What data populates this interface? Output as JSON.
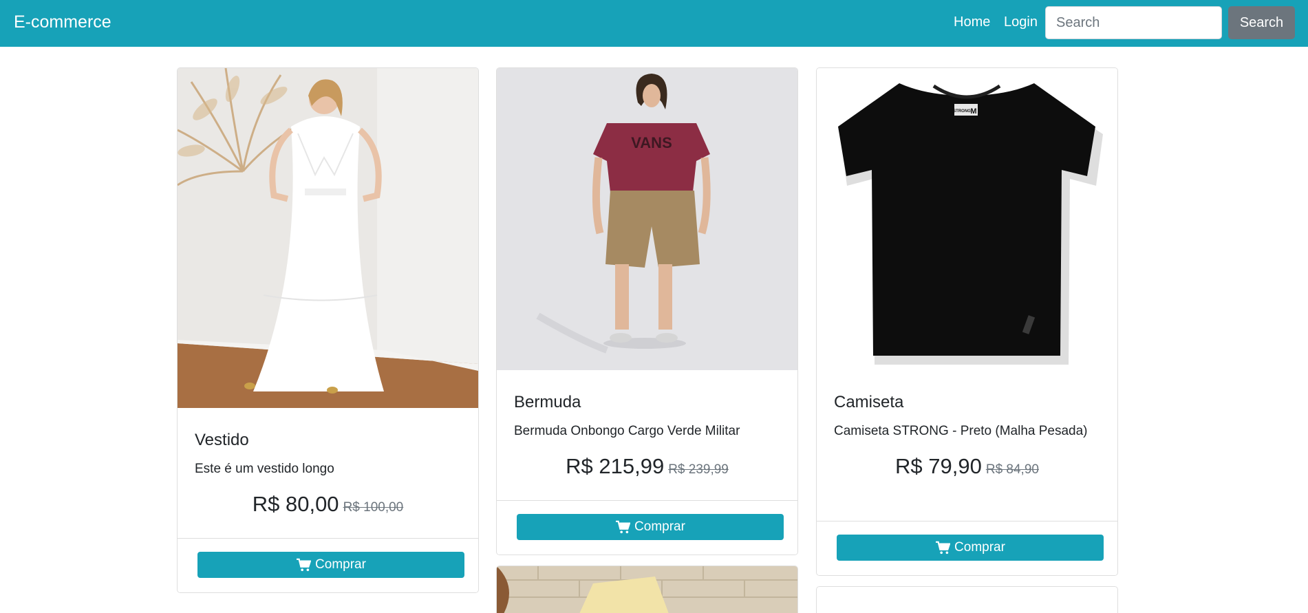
{
  "navbar": {
    "brand": "E-commerce",
    "links": [
      "Home",
      "Login"
    ],
    "search_placeholder": "Search",
    "search_button": "Search"
  },
  "products": [
    {
      "title": "Vestido",
      "description": "Este é um vestido longo",
      "price": "R$ 80,00",
      "old_price": "R$ 100,00",
      "button": "Comprar",
      "image_icon": "white-dress-photo"
    },
    {
      "title": "Bermuda",
      "description": "Bermuda Onbongo Cargo Verde Militar",
      "price": "R$ 215,99",
      "old_price": "R$ 239,99",
      "button": "Comprar",
      "image_icon": "shorts-model-photo",
      "image_text": "VANS"
    },
    {
      "title": "Camiseta",
      "description": "Camiseta STRONG - Preto (Malha Pesada)",
      "price": "R$ 79,90",
      "old_price": "R$ 84,90",
      "button": "Comprar",
      "image_icon": "black-tshirt-photo",
      "image_text": "STRONG"
    }
  ],
  "colors": {
    "navbar": "#17a2b8",
    "button": "#17a2b8",
    "search_button": "#6c757d"
  }
}
